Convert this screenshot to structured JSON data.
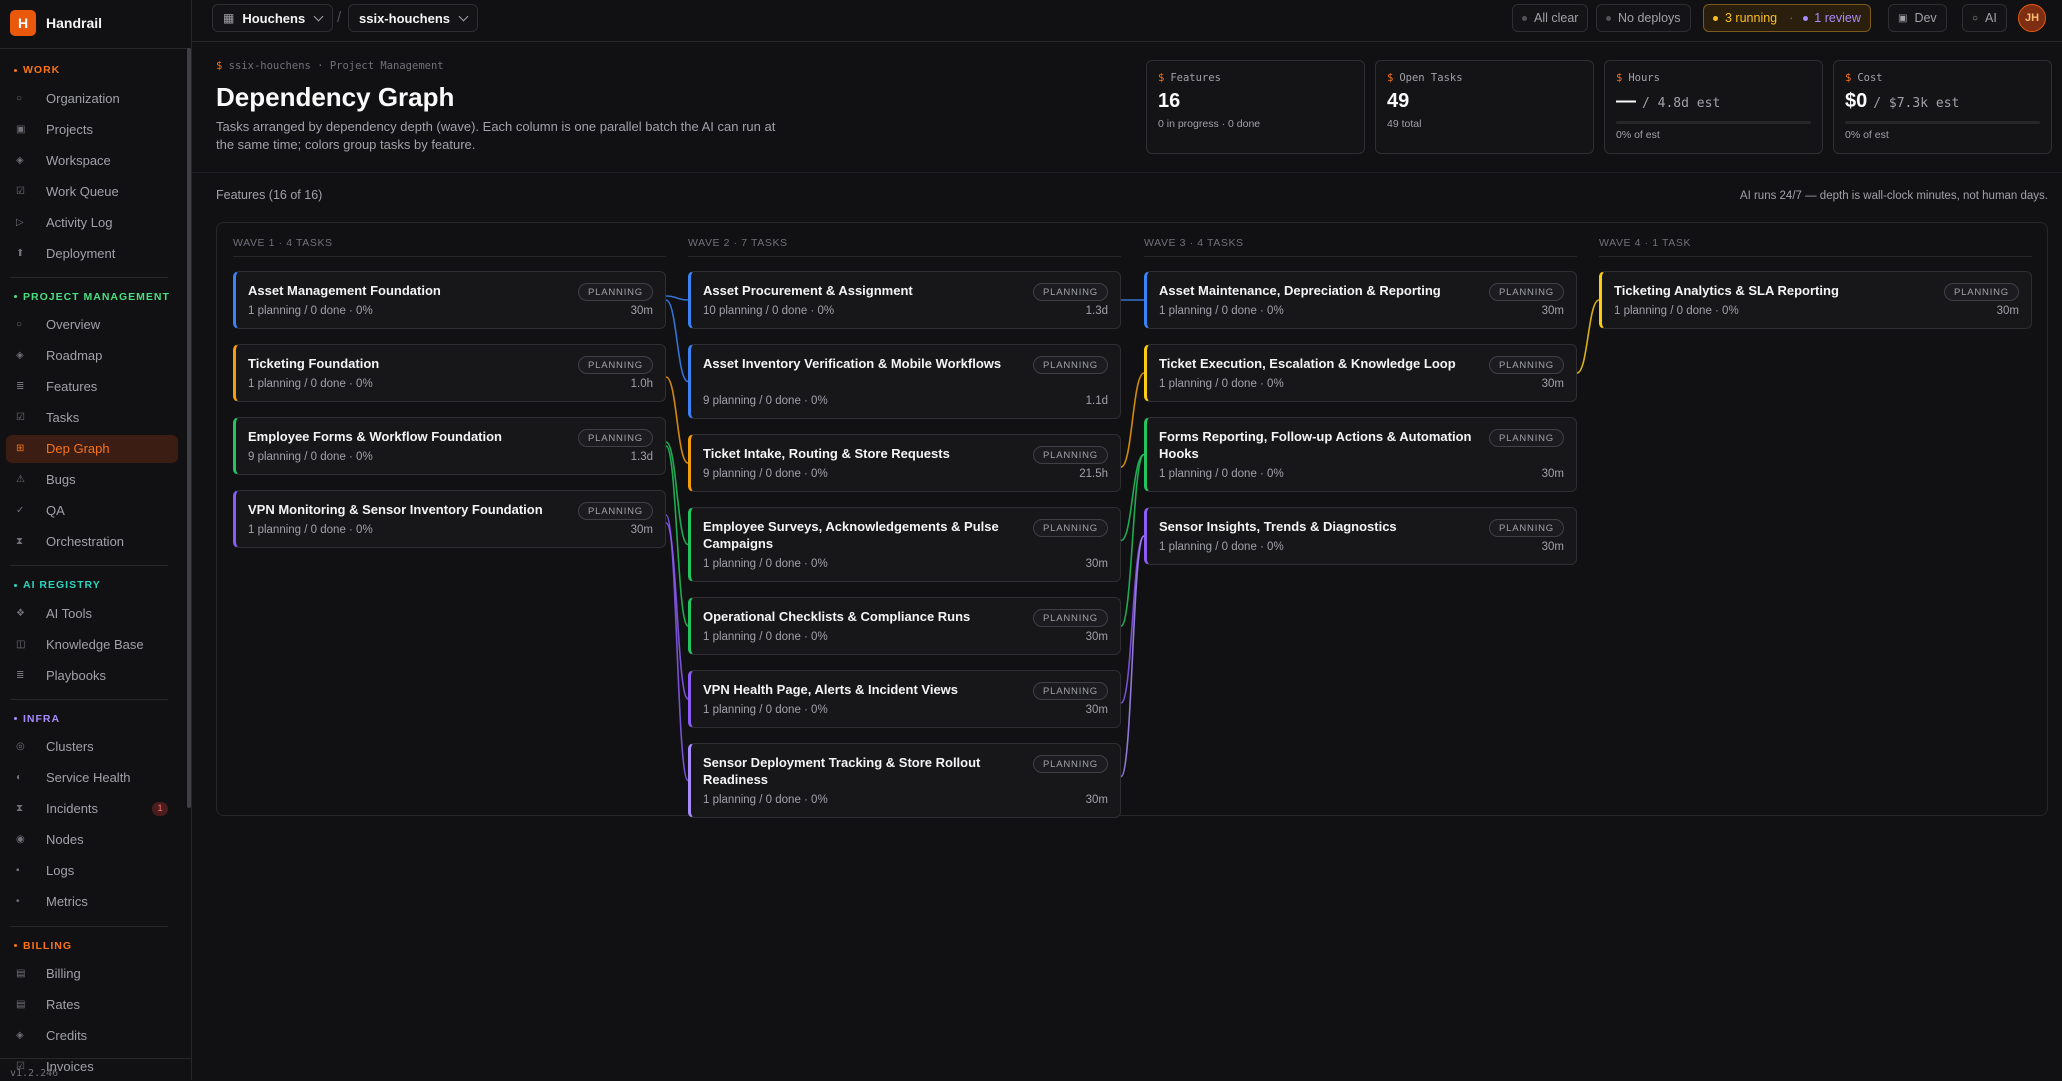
{
  "brand": {
    "logo_letter": "H",
    "name": "Handrail"
  },
  "sidebar": {
    "sections": [
      {
        "label": "WORK",
        "color": "#f97316",
        "items": [
          {
            "label": "Organization",
            "icon": "circle-icon"
          },
          {
            "label": "Projects",
            "icon": "square-icon"
          },
          {
            "label": "Workspace",
            "icon": "diamond-icon"
          },
          {
            "label": "Work Queue",
            "icon": "checkbox-icon"
          },
          {
            "label": "Activity Log",
            "icon": "triangle-icon"
          },
          {
            "label": "Deployment",
            "icon": "upload-icon"
          }
        ]
      },
      {
        "label": "PROJECT MANAGEMENT",
        "color": "#4ade80",
        "items": [
          {
            "label": "Overview",
            "icon": "circle-icon"
          },
          {
            "label": "Roadmap",
            "icon": "diamond-icon"
          },
          {
            "label": "Features",
            "icon": "list-icon"
          },
          {
            "label": "Tasks",
            "icon": "checkbox-icon"
          },
          {
            "label": "Dep Graph",
            "icon": "graph-icon",
            "active": true
          },
          {
            "label": "Bugs",
            "icon": "warning-icon"
          },
          {
            "label": "QA",
            "icon": "check-icon"
          },
          {
            "label": "Orchestration",
            "icon": "hourglass-icon"
          }
        ]
      },
      {
        "label": "AI REGISTRY",
        "color": "#2dd4bf",
        "items": [
          {
            "label": "AI Tools",
            "icon": "tool-icon"
          },
          {
            "label": "Knowledge Base",
            "icon": "book-icon"
          },
          {
            "label": "Playbooks",
            "icon": "list-icon"
          }
        ]
      },
      {
        "label": "INFRA",
        "color": "#a78bfa",
        "items": [
          {
            "label": "Clusters",
            "icon": "cluster-icon"
          },
          {
            "label": "Service Health",
            "icon": "half-circle-icon"
          },
          {
            "label": "Incidents",
            "icon": "hourglass-icon",
            "badge": "1"
          },
          {
            "label": "Nodes",
            "icon": "node-icon"
          },
          {
            "label": "Logs",
            "icon": "log-icon"
          },
          {
            "label": "Metrics",
            "icon": "dot-icon"
          }
        ]
      },
      {
        "label": "BILLING",
        "color": "#f97316",
        "items": [
          {
            "label": "Billing",
            "icon": "grid-icon"
          },
          {
            "label": "Rates",
            "icon": "grid-icon"
          },
          {
            "label": "Credits",
            "icon": "diamond-icon"
          },
          {
            "label": "Invoices",
            "icon": "checkbox-icon"
          }
        ]
      }
    ],
    "version": "v1.2.246"
  },
  "topbar": {
    "org": "Houchens",
    "project": "ssix-houchens",
    "all_clear": "All clear",
    "no_deploys": "No deploys",
    "running": "3 running",
    "review": "1 review",
    "dev": "Dev",
    "ai": "AI",
    "avatar": "JH"
  },
  "page": {
    "breadcrumb_project": "ssix-houchens",
    "breadcrumb_section": "Project Management",
    "title": "Dependency Graph",
    "description": "Tasks arranged by dependency depth (wave). Each column is one parallel batch the AI can run at the same time; colors group tasks by feature.",
    "features_label": "Features (16 of 16)",
    "ai_note": "AI runs 24/7 — depth is wall-clock minutes, not human days."
  },
  "stats": [
    {
      "label": "Features",
      "value": "16",
      "sub": "",
      "note": "0 in progress · 0 done"
    },
    {
      "label": "Open Tasks",
      "value": "49",
      "sub": "",
      "note": "49 total"
    },
    {
      "label": "Hours",
      "value": "—",
      "sub": "/ 4.8d est",
      "note": "0% of est",
      "progress": 0
    },
    {
      "label": "Cost",
      "value": "$0",
      "sub": "/ $7.3k est",
      "note": "0% of est",
      "progress": 0
    }
  ],
  "colors": {
    "blue": "#3b82f6",
    "orange": "#f59e0b",
    "green": "#22c55e",
    "purple": "#8b5cf6",
    "yellow": "#facc15"
  },
  "waves": [
    {
      "label": "WAVE 1 · 4 TASKS",
      "tasks": [
        {
          "title": "Asset Management Foundation",
          "meta": "1 planning / 0 done · 0%",
          "duration": "30m",
          "status": "PLANNING",
          "color": "#3b82f6"
        },
        {
          "title": "Ticketing Foundation",
          "meta": "1 planning / 0 done · 0%",
          "duration": "1.0h",
          "status": "PLANNING",
          "color": "#f59e0b"
        },
        {
          "title": "Employee Forms & Workflow Foundation",
          "meta": "9 planning / 0 done · 0%",
          "duration": "1.3d",
          "status": "PLANNING",
          "color": "#22c55e"
        },
        {
          "title": "VPN Monitoring & Sensor Inventory Foundation",
          "meta": "1 planning / 0 done · 0%",
          "duration": "30m",
          "status": "PLANNING",
          "color": "#8b5cf6"
        }
      ]
    },
    {
      "label": "WAVE 2 · 7 TASKS",
      "tasks": [
        {
          "title": "Asset Procurement & Assignment",
          "meta": "10 planning / 0 done · 0%",
          "duration": "1.3d",
          "status": "PLANNING",
          "color": "#3b82f6"
        },
        {
          "title": "Asset Inventory Verification & Mobile Workflows",
          "meta": "9 planning / 0 done · 0%",
          "duration": "1.1d",
          "status": "PLANNING",
          "color": "#3b82f6"
        },
        {
          "title": "Ticket Intake, Routing & Store Requests",
          "meta": "9 planning / 0 done · 0%",
          "duration": "21.5h",
          "status": "PLANNING",
          "color": "#f59e0b"
        },
        {
          "title": "Employee Surveys, Acknowledgements & Pulse Campaigns",
          "meta": "1 planning / 0 done · 0%",
          "duration": "30m",
          "status": "PLANNING",
          "color": "#22c55e"
        },
        {
          "title": "Operational Checklists & Compliance Runs",
          "meta": "1 planning / 0 done · 0%",
          "duration": "30m",
          "status": "PLANNING",
          "color": "#22c55e"
        },
        {
          "title": "VPN Health Page, Alerts & Incident Views",
          "meta": "1 planning / 0 done · 0%",
          "duration": "30m",
          "status": "PLANNING",
          "color": "#8b5cf6"
        },
        {
          "title": "Sensor Deployment Tracking & Store Rollout Readiness",
          "meta": "1 planning / 0 done · 0%",
          "duration": "30m",
          "status": "PLANNING",
          "color": "#a78bfa"
        }
      ]
    },
    {
      "label": "WAVE 3 · 4 TASKS",
      "tasks": [
        {
          "title": "Asset Maintenance, Depreciation & Reporting",
          "meta": "1 planning / 0 done · 0%",
          "duration": "30m",
          "status": "PLANNING",
          "color": "#3b82f6"
        },
        {
          "title": "Ticket Execution, Escalation & Knowledge Loop",
          "meta": "1 planning / 0 done · 0%",
          "duration": "30m",
          "status": "PLANNING",
          "color": "#facc15"
        },
        {
          "title": "Forms Reporting, Follow-up Actions & Automation Hooks",
          "meta": "1 planning / 0 done · 0%",
          "duration": "30m",
          "status": "PLANNING",
          "color": "#22c55e"
        },
        {
          "title": "Sensor Insights, Trends & Diagnostics",
          "meta": "1 planning / 0 done · 0%",
          "duration": "30m",
          "status": "PLANNING",
          "color": "#8b5cf6"
        }
      ]
    },
    {
      "label": "WAVE 4 · 1 TASK",
      "tasks": [
        {
          "title": "Ticketing Analytics & SLA Reporting",
          "meta": "1 planning / 0 done · 0%",
          "duration": "30m",
          "status": "PLANNING",
          "color": "#facc15"
        }
      ]
    }
  ],
  "edges": [
    {
      "from": [
        0,
        0
      ],
      "to": [
        1,
        0
      ],
      "color": "#3b82f6"
    },
    {
      "from": [
        0,
        0
      ],
      "to": [
        1,
        1
      ],
      "color": "#3b82f6"
    },
    {
      "from": [
        0,
        1
      ],
      "to": [
        1,
        2
      ],
      "color": "#f59e0b"
    },
    {
      "from": [
        0,
        2
      ],
      "to": [
        1,
        3
      ],
      "color": "#22c55e"
    },
    {
      "from": [
        0,
        2
      ],
      "to": [
        1,
        4
      ],
      "color": "#22c55e"
    },
    {
      "from": [
        0,
        3
      ],
      "to": [
        1,
        5
      ],
      "color": "#8b5cf6"
    },
    {
      "from": [
        0,
        3
      ],
      "to": [
        1,
        6
      ],
      "color": "#8b5cf6"
    },
    {
      "from": [
        1,
        0
      ],
      "to": [
        2,
        0
      ],
      "color": "#3b82f6"
    },
    {
      "from": [
        1,
        2
      ],
      "to": [
        2,
        1
      ],
      "color": "#f59e0b"
    },
    {
      "from": [
        1,
        3
      ],
      "to": [
        2,
        2
      ],
      "color": "#22c55e"
    },
    {
      "from": [
        1,
        4
      ],
      "to": [
        2,
        2
      ],
      "color": "#22c55e"
    },
    {
      "from": [
        1,
        5
      ],
      "to": [
        2,
        3
      ],
      "color": "#8b5cf6"
    },
    {
      "from": [
        1,
        6
      ],
      "to": [
        2,
        3
      ],
      "color": "#a78bfa"
    },
    {
      "from": [
        2,
        1
      ],
      "to": [
        3,
        0
      ],
      "color": "#facc15"
    }
  ]
}
